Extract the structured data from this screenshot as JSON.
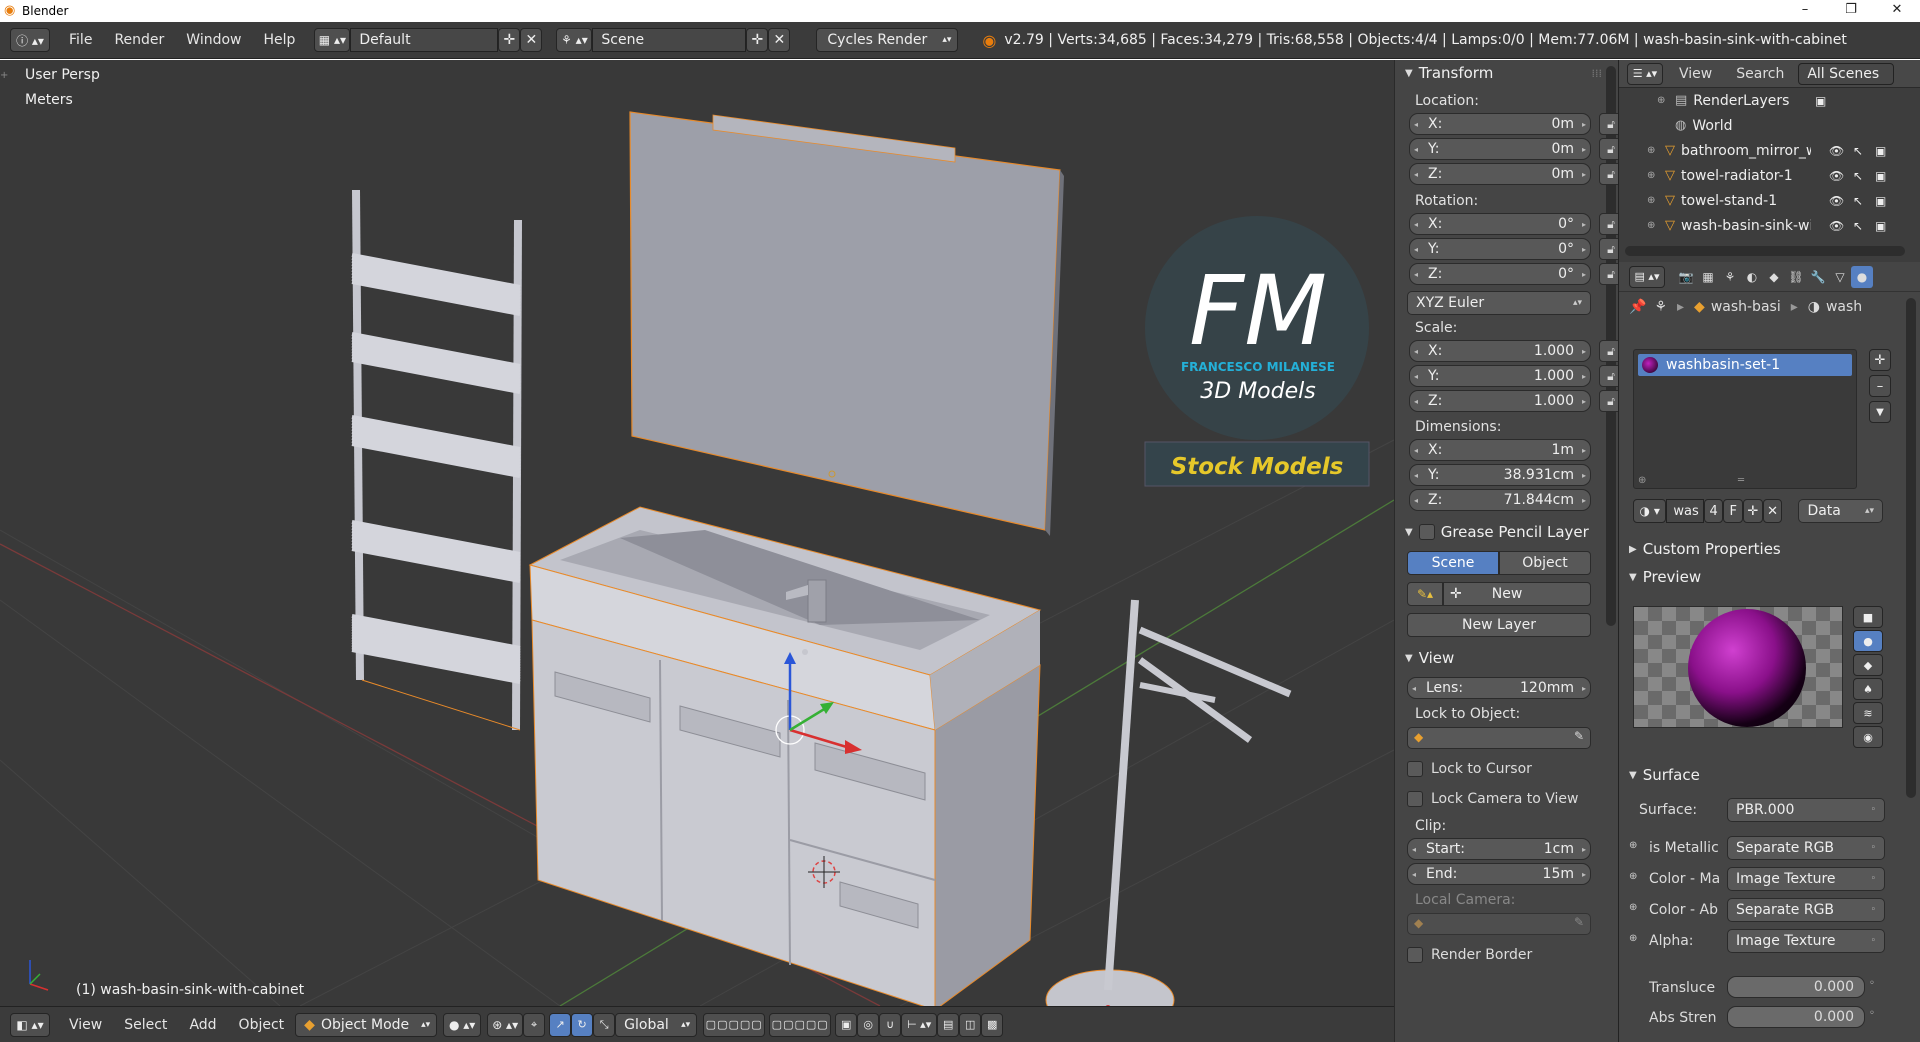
{
  "window": {
    "title": "Blender",
    "minimize": "–",
    "maximize": "❐",
    "close": "✕"
  },
  "menu": {
    "file": "File",
    "render": "Render",
    "window": "Window",
    "help": "Help"
  },
  "header": {
    "layout": "Default",
    "scene": "Scene",
    "engine": "Cycles Render",
    "stats": "v2.79 | Verts:34,685 | Faces:34,279 | Tris:68,558 | Objects:4/4 | Lamps:0/0 | Mem:77.06M | wash-basin-sink-with-cabinet"
  },
  "viewport": {
    "persp_label": "User Persp",
    "units_label": "Meters",
    "selected_label": "(1) wash-basin-sink-with-cabinet",
    "logo": {
      "initials": "FM",
      "name": "FRANCESCO MILANESE",
      "tagline": "3D Models",
      "banner": "Stock Models"
    }
  },
  "footer": {
    "view": "View",
    "select": "Select",
    "add": "Add",
    "object": "Object",
    "mode": "Object Mode",
    "orientation": "Global"
  },
  "transform": {
    "title": "Transform",
    "location_label": "Location:",
    "location": [
      {
        "k": "X:",
        "v": "0m"
      },
      {
        "k": "Y:",
        "v": "0m"
      },
      {
        "k": "Z:",
        "v": "0m"
      }
    ],
    "rotation_label": "Rotation:",
    "rotation": [
      {
        "k": "X:",
        "v": "0°"
      },
      {
        "k": "Y:",
        "v": "0°"
      },
      {
        "k": "Z:",
        "v": "0°"
      }
    ],
    "rotation_mode": "XYZ Euler",
    "scale_label": "Scale:",
    "scale": [
      {
        "k": "X:",
        "v": "1.000"
      },
      {
        "k": "Y:",
        "v": "1.000"
      },
      {
        "k": "Z:",
        "v": "1.000"
      }
    ],
    "dimensions_label": "Dimensions:",
    "dimensions": [
      {
        "k": "X:",
        "v": "1m"
      },
      {
        "k": "Y:",
        "v": "38.931cm"
      },
      {
        "k": "Z:",
        "v": "71.844cm"
      }
    ]
  },
  "grease_pencil": {
    "title": "Grease Pencil Layer",
    "scene_tab": "Scene",
    "object_tab": "Object",
    "new": "New",
    "new_layer": "New Layer"
  },
  "view_panel": {
    "title": "View",
    "lens_label": "Lens:",
    "lens_value": "120mm",
    "lock_to_object": "Lock to Object:",
    "lock_to_cursor": "Lock to Cursor",
    "lock_camera": "Lock Camera to View",
    "clip_label": "Clip:",
    "clip_start_label": "Start:",
    "clip_start": "1cm",
    "clip_end_label": "End:",
    "clip_end": "15m",
    "local_camera": "Local Camera:",
    "render_border": "Render Border"
  },
  "outliner": {
    "view": "View",
    "search": "Search",
    "filter": "All Scenes",
    "items": [
      {
        "label": "RenderLayers",
        "icon": "renderlayers-icon"
      },
      {
        "label": "World",
        "icon": "world-icon"
      },
      {
        "label": "bathroom_mirror_w",
        "icon": "mesh-icon"
      },
      {
        "label": "towel-radiator-1",
        "icon": "mesh-icon"
      },
      {
        "label": "towel-stand-1",
        "icon": "mesh-icon"
      },
      {
        "label": "wash-basin-sink-wi",
        "icon": "mesh-icon"
      }
    ]
  },
  "material": {
    "breadcrumb_obj": "wash-basi",
    "breadcrumb_mat": "wash",
    "slot": "washbasin-set-1",
    "datablock_name": "was",
    "users": "4",
    "fake_user": "F",
    "link": "Data",
    "custom_props": "Custom Properties",
    "preview": "Preview",
    "surface_title": "Surface",
    "surface_label": "Surface:",
    "surface_value": "PBR.000",
    "inputs": [
      {
        "label": "is Metallic",
        "value": "Separate RGB"
      },
      {
        "label": "Color - Ma",
        "value": "Image Texture"
      },
      {
        "label": "Color - Ab",
        "value": "Separate RGB"
      },
      {
        "label": "Alpha:",
        "value": "Image Texture"
      }
    ],
    "translucency_label": "Transluce",
    "translucency": "0.000",
    "abs_label": "Abs Stren",
    "abs": "0.000"
  }
}
